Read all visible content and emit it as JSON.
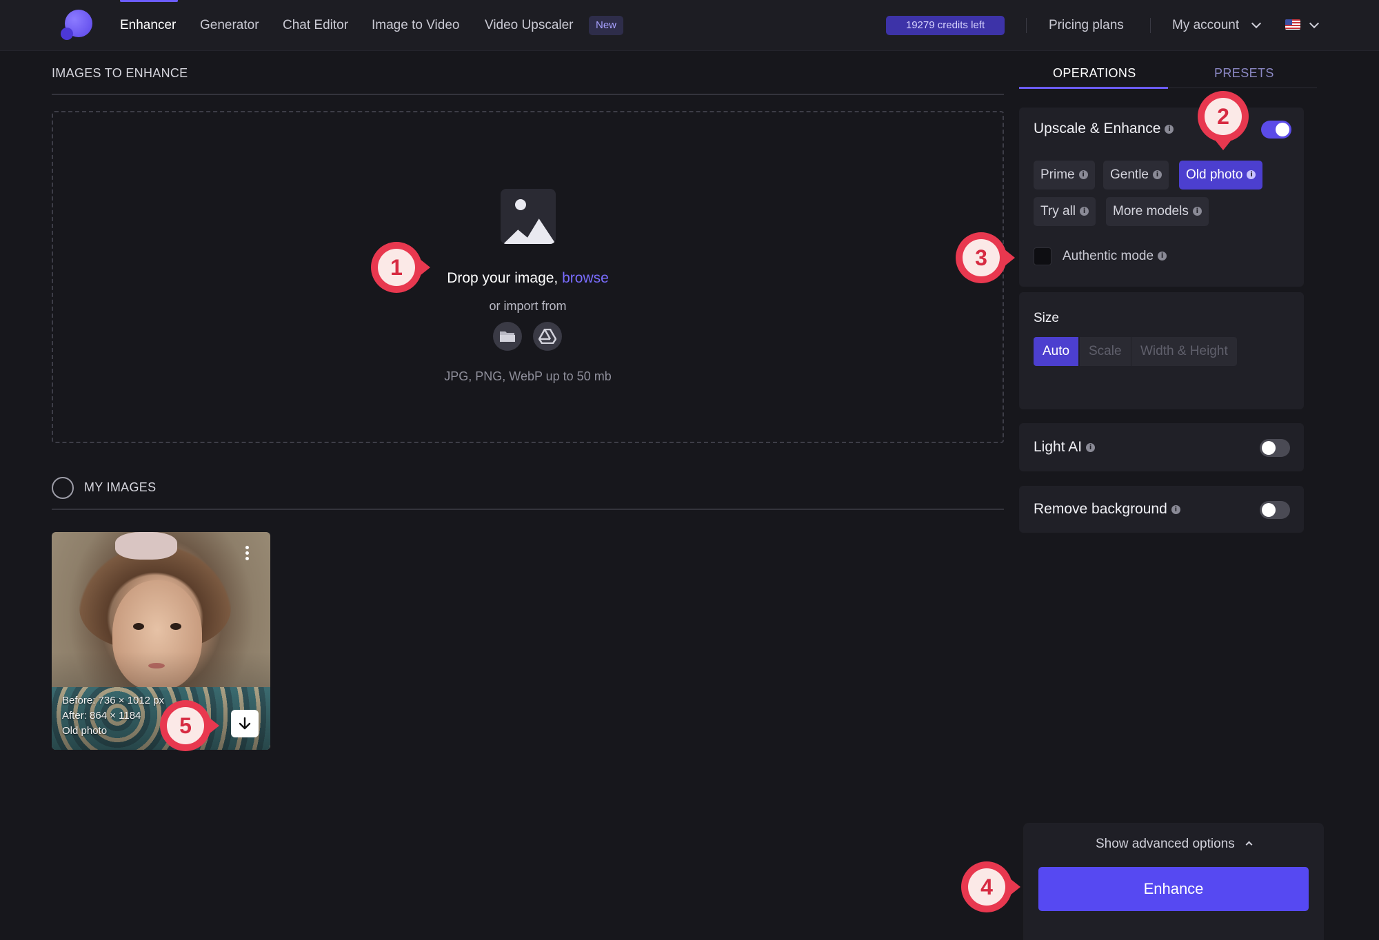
{
  "nav": {
    "items": [
      "Enhancer",
      "Generator",
      "Chat Editor",
      "Image to Video",
      "Video Upscaler"
    ],
    "new_badge": "New",
    "credits": "19279 credits left",
    "pricing": "Pricing plans",
    "account": "My account"
  },
  "upload": {
    "section_title": "IMAGES TO ENHANCE",
    "drop_text": "Drop your image,",
    "browse": "browse",
    "import_text": "or import from",
    "formats": "JPG, PNG, WebP up to 50 mb"
  },
  "my_images": {
    "title": "MY IMAGES",
    "items": [
      {
        "before": "Before:  736 × 1012 px",
        "after": "After:    864 × 1184",
        "model": "Old photo"
      }
    ]
  },
  "panel": {
    "tabs": [
      "OPERATIONS",
      "PRESETS"
    ],
    "upscale": {
      "title": "Upscale & Enhance",
      "models": [
        "Prime",
        "Gentle",
        "Old photo",
        "Try all",
        "More models"
      ],
      "selected_model": "Old photo",
      "authentic_mode": "Authentic mode"
    },
    "size": {
      "title": "Size",
      "options": [
        "Auto",
        "Scale",
        "Width & Height"
      ],
      "selected": "Auto"
    },
    "light_ai": "Light AI",
    "remove_bg": "Remove background",
    "advanced": "Show advanced options",
    "enhance_button": "Enhance"
  },
  "callouts": [
    "1",
    "2",
    "3",
    "4",
    "5"
  ],
  "colors": {
    "accent": "#5649f2",
    "callout": "#e8384f",
    "background": "#17171c"
  }
}
